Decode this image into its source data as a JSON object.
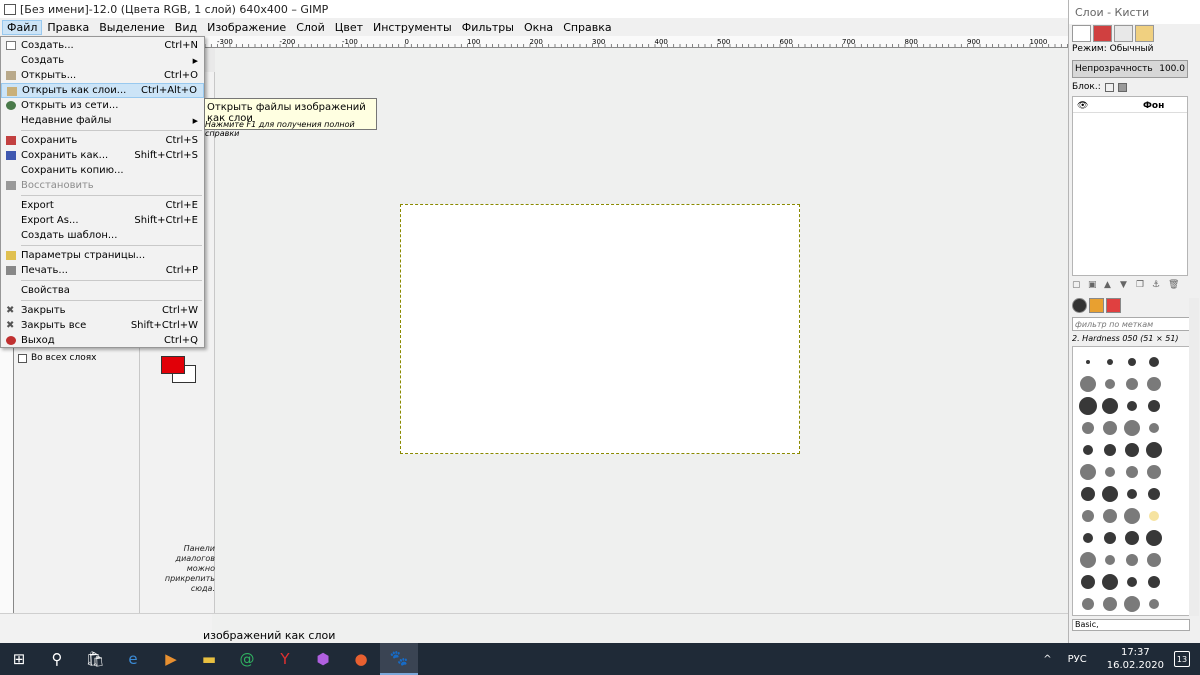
{
  "window": {
    "title": "[Без имени]-12.0 (Цвета RGB, 1 слой) 640x400 – GIMP"
  },
  "menubar": [
    "Файл",
    "Правка",
    "Выделение",
    "Вид",
    "Изображение",
    "Слой",
    "Цвет",
    "Инструменты",
    "Фильтры",
    "Окна",
    "Справка"
  ],
  "file_menu": {
    "items": [
      {
        "label": "Создать...",
        "shortcut": "Ctrl+N"
      },
      {
        "label": "Создать",
        "shortcut": ""
      },
      {
        "label": "Открыть...",
        "shortcut": "Ctrl+O"
      },
      {
        "label": "Открыть как слои...",
        "shortcut": "Ctrl+Alt+O"
      },
      {
        "label": "Открыть из сети...",
        "shortcut": ""
      },
      {
        "label": "Недавние файлы",
        "shortcut": ""
      },
      {
        "label": "Сохранить",
        "shortcut": "Ctrl+S"
      },
      {
        "label": "Сохранить как...",
        "shortcut": "Shift+Ctrl+S"
      },
      {
        "label": "Сохранить копию...",
        "shortcut": ""
      },
      {
        "label": "Восстановить",
        "shortcut": ""
      },
      {
        "label": "Export",
        "shortcut": "Ctrl+E"
      },
      {
        "label": "Export As...",
        "shortcut": "Shift+Ctrl+E"
      },
      {
        "label": "Создать шаблон...",
        "shortcut": ""
      },
      {
        "label": "Параметры страницы...",
        "shortcut": ""
      },
      {
        "label": "Печать...",
        "shortcut": "Ctrl+P"
      },
      {
        "label": "Свойства",
        "shortcut": ""
      },
      {
        "label": "Закрыть",
        "shortcut": "Ctrl+W"
      },
      {
        "label": "Закрыть все",
        "shortcut": "Shift+Ctrl+W"
      },
      {
        "label": "Выход",
        "shortcut": "Ctrl+Q"
      }
    ]
  },
  "tooltip": {
    "title": "Открыть файлы изображений как слои",
    "hint": "Нажмите F1 для получения полной справки"
  },
  "ruler": {
    "ticks": [
      "-300",
      "-200",
      "-100",
      "0",
      "100",
      "200",
      "300",
      "400",
      "500",
      "600",
      "700",
      "800",
      "900",
      "1000"
    ]
  },
  "toolbox": {
    "all_layers_label": "Во всех слоях",
    "dock_hint": "Панели диалогов можно прикрепить сюда.",
    "fg_color": "#e10008",
    "bg_color": "#ffffff"
  },
  "status": {
    "text": "изображений как слои"
  },
  "dock": {
    "title": "Слои - Кисти",
    "mode_label": "Режим: Обычный",
    "opacity_label": "Непрозрачность",
    "opacity_value": "100.0",
    "lock_label": "Блок.:",
    "layer_name": "Фон",
    "brush_filter_placeholder": "фильтр по меткам",
    "brush_name": "2. Hardness 050 (51 × 51)",
    "brush_set": "Basic,"
  },
  "taskbar": {
    "lang": "РУС",
    "time": "17:37",
    "date": "16.02.2020",
    "notifications": "13"
  }
}
